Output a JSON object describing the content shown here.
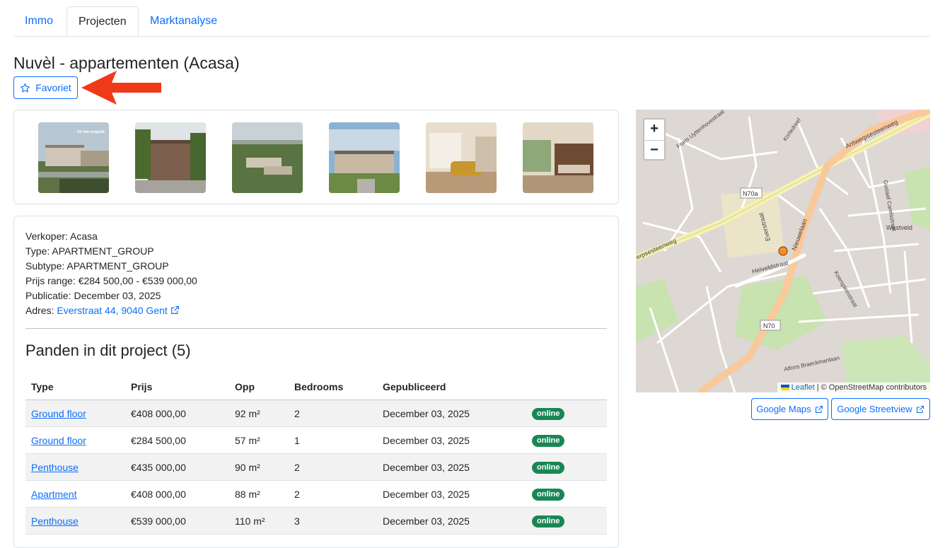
{
  "tabs": [
    {
      "label": "Immo",
      "active": false
    },
    {
      "label": "Projecten",
      "active": true
    },
    {
      "label": "Marktanalyse",
      "active": false
    }
  ],
  "title": "Nuvèl - appartementen (Acasa)",
  "favorite_label": "Favoriet",
  "info": {
    "verkoper": "Verkoper: Acasa",
    "type": "Type: APARTMENT_GROUP",
    "subtype": "Subtype: APARTMENT_GROUP",
    "prijs": "Prijs range: €284 500,00 - €539 000,00",
    "publicatie": "Publicatie: December 03, 2025",
    "adres_label": "Adres:",
    "adres_link": "Everstraat 44, 9040 Gent"
  },
  "gallery_badge": "0% btw mogelijk",
  "section_title": "Panden in dit project (5)",
  "table": {
    "headers": [
      "Type",
      "Prijs",
      "Opp",
      "Bedrooms",
      "Gepubliceerd",
      ""
    ],
    "rows": [
      {
        "type": "Ground floor",
        "prijs": "€408 000,00",
        "opp": "92 m²",
        "bedrooms": "2",
        "date": "December 03, 2025",
        "status": "online"
      },
      {
        "type": "Ground floor",
        "prijs": "€284 500,00",
        "opp": "57 m²",
        "bedrooms": "1",
        "date": "December 03, 2025",
        "status": "online"
      },
      {
        "type": "Penthouse",
        "prijs": "€435 000,00",
        "opp": "90 m²",
        "bedrooms": "2",
        "date": "December 03, 2025",
        "status": "online"
      },
      {
        "type": "Apartment",
        "prijs": "€408 000,00",
        "opp": "88 m²",
        "bedrooms": "2",
        "date": "December 03, 2025",
        "status": "online"
      },
      {
        "type": "Penthouse",
        "prijs": "€539 000,00",
        "opp": "110 m²",
        "bedrooms": "3",
        "date": "December 03, 2025",
        "status": "online"
      }
    ]
  },
  "map": {
    "zoom_in": "+",
    "zoom_out": "−",
    "attribution_link": "Leaflet",
    "attribution_rest": "| © OpenStreetMap contributors",
    "labels": {
      "antwerpsesteenweg": "Antwerpsesteenweg",
      "erpsesteenweg": "erpsesteenweg",
      "nieuwelaan": "Nieuwelaan",
      "n70a": "N70a",
      "n70": "N70",
      "westveld": "Westveld",
      "heiveldstraat": "Heiveldstraat",
      "everstraat": "Everstraat",
      "alfons": "Alfons Braeckmanlaan",
      "frans": "Frans Uyttenhovestraat",
      "gustaaf": "Gustaaf Carelsstraat",
      "koerspleinstraat": "Koerspleinstraat",
      "kortedreef": "Kortedreef"
    }
  },
  "map_buttons": {
    "google_maps": "Google Maps",
    "google_streetview": "Google Streetview"
  },
  "colors": {
    "primary": "#0d6efd",
    "online_badge": "#198754",
    "arrow": "#f03a17"
  }
}
